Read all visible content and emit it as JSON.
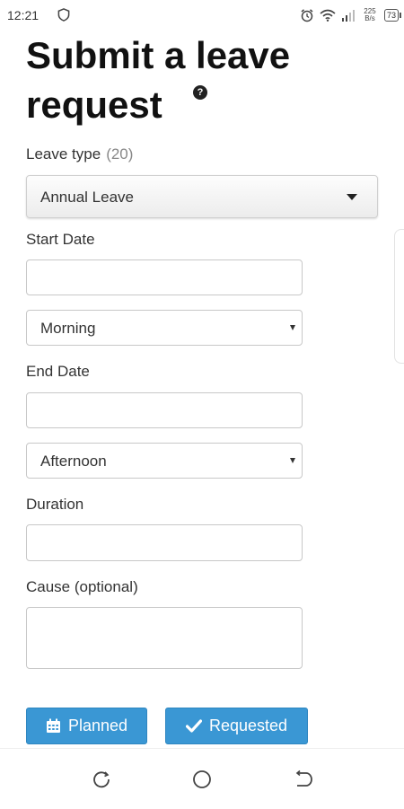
{
  "status_bar": {
    "time": "12:21",
    "net_speed_value": "225",
    "net_speed_unit": "B/s",
    "battery": "73"
  },
  "form": {
    "title": "Submit a leave request",
    "help_icon": "question-circle-icon",
    "leave_type": {
      "label": "Leave type",
      "count": "(20)",
      "selected": "Annual Leave"
    },
    "start_date": {
      "label": "Start Date",
      "value": "",
      "period": "Morning"
    },
    "end_date": {
      "label": "End Date",
      "value": "",
      "period": "Afternoon"
    },
    "duration": {
      "label": "Duration",
      "value": ""
    },
    "cause": {
      "label": "Cause (optional)",
      "value": ""
    }
  },
  "actions": {
    "planned": {
      "label": "Planned",
      "icon": "calendar-icon"
    },
    "requested": {
      "label": "Requested",
      "icon": "check-icon"
    }
  },
  "colors": {
    "primary_button": "#3a97d4",
    "text": "#222222"
  }
}
